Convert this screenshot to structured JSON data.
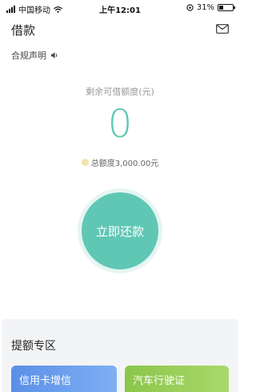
{
  "status_bar": {
    "carrier": "中国移动",
    "time": "上午12:01",
    "battery": "31%",
    "battery_level": 0.31
  },
  "header": {
    "title": "借款",
    "mail_icon": "mail-icon"
  },
  "compliance": {
    "label": "合规声明",
    "icon": "speaker-icon"
  },
  "quota": {
    "label": "剩余可借额度(元)",
    "value": "0",
    "total": "总额度3,000.00元",
    "accent_color": "#5fc7b2"
  },
  "actions": {
    "repay_label": "立即还款"
  },
  "boost": {
    "title": "提额专区",
    "cards": [
      {
        "label": "信用卡增信",
        "color": "#5a8fe6"
      },
      {
        "label": "汽车行驶证",
        "color": "#8bc64a"
      }
    ]
  }
}
